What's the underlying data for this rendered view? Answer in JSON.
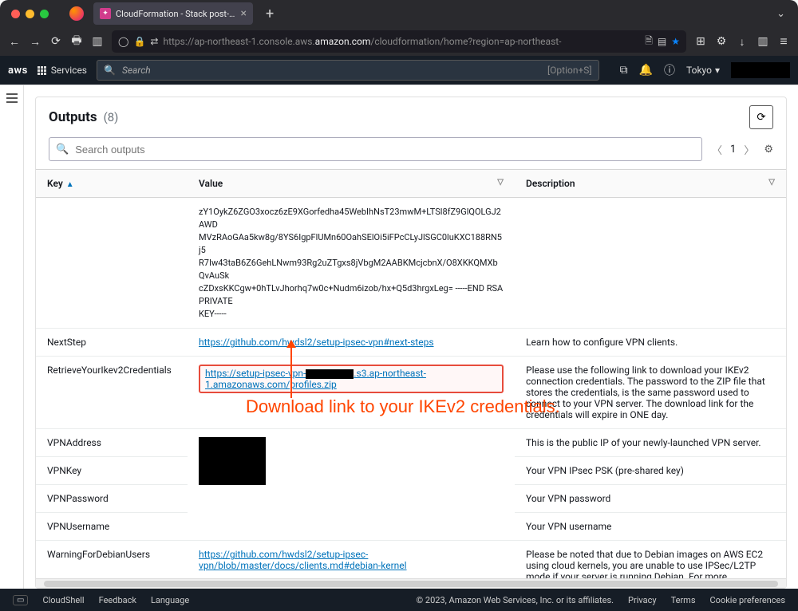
{
  "browser": {
    "tab_title": "CloudFormation - Stack post-t…",
    "url_prefix": "https://ap-northeast-1.console.aws.",
    "url_bold": "amazon.com",
    "url_suffix": "/cloudformation/home?region=ap-northeast-"
  },
  "aws_header": {
    "services": "Services",
    "search_placeholder": "Search",
    "search_hint": "[Option+S]",
    "region": "Tokyo"
  },
  "panel": {
    "title": "Outputs",
    "count": "(8)",
    "search_placeholder": "Search outputs",
    "page": "1"
  },
  "columns": {
    "key": "Key",
    "value": "Value",
    "description": "Description"
  },
  "rows": [
    {
      "key": "",
      "value_lines": [
        "zY1OykZ6ZGO3xocz6zE9XGorfedha45WebIhNsT23mwM+LTSl8fZ9GlQOLGJ2AWD",
        "MVzRAoGAa5kw8g/8YS6IgpFlUMn60OahSElOi5iFPcCLyJlSGC0luKXC188RN5j5",
        "R7Iw43taB6Z6GehLNwm93Rg2uZTgxs8jVbgM2AABKMcjcbnX/O8XKKQMXbQvAuSk",
        "cZDxsKKCgw+0hTLvJhorhq7w0c+Nudm6izob/hx+Q5d3hrgxLeg= -----END RSA PRIVATE",
        "KEY-----"
      ],
      "description": ""
    },
    {
      "key": "NextStep",
      "link": "https://github.com/hwdsl2/setup-ipsec-vpn#next-steps",
      "description": "Learn how to configure VPN clients."
    },
    {
      "key": "RetrieveYourIkev2Credentials",
      "link_pre": "https://setup-ipsec-vpn-",
      "link_post": ".s3.ap-northeast-1.amazonaws.com/profiles.zip",
      "description": "Please use the following link to download your IKEv2 connection credentials. The password to the ZIP file that stores the credentials, is the same password used to connect to your VPN server. The download link for the credentials will expire in ONE day."
    },
    {
      "key": "VPNAddress",
      "value": "",
      "description": "This is the public IP of your newly-launched VPN server."
    },
    {
      "key": "VPNKey",
      "value": "",
      "description": "Your VPN IPsec PSK (pre-shared key)"
    },
    {
      "key": "VPNPassword",
      "value": "",
      "description": "Your VPN password"
    },
    {
      "key": "VPNUsername",
      "value": "",
      "description": "Your VPN username"
    },
    {
      "key": "WarningForDebianUsers",
      "link": "https://github.com/hwdsl2/setup-ipsec-vpn/blob/master/docs/clients.md#debian-kernel",
      "description": "Please be noted that due to Debian images on AWS EC2 using cloud kernels, you are unable to use IPSec/L2TP mode if your server is running Debian. For more information, please refer to the link to the left."
    }
  ],
  "annotation": "Download link to your IKEv2 credentials.",
  "footer": {
    "cloudshell": "CloudShell",
    "feedback": "Feedback",
    "language": "Language",
    "copyright": "© 2023, Amazon Web Services, Inc. or its affiliates.",
    "privacy": "Privacy",
    "terms": "Terms",
    "cookies": "Cookie preferences"
  }
}
